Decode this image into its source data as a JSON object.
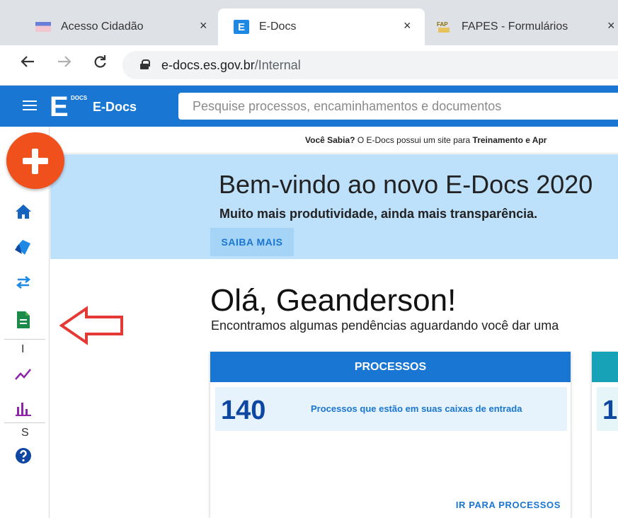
{
  "browser": {
    "tabs": [
      {
        "label": "Acesso Cidadão",
        "active": false
      },
      {
        "label": "E-Docs",
        "active": true
      },
      {
        "label": "FAPES - Formulários",
        "active": false
      }
    ],
    "close_glyph": "×",
    "url_host": "e-docs.es.gov.br",
    "url_path": "/Internal"
  },
  "header": {
    "logo_letter": "E",
    "logo_small": "DOCS",
    "brand": "E-Docs",
    "search_placeholder": "Pesquise processos, encaminhamentos e documentos"
  },
  "sidebar": {
    "section_letters": [
      "I",
      "S"
    ],
    "icons": [
      "home-icon",
      "tags-icon",
      "exchange-icon",
      "document-icon",
      "trend-chart-icon",
      "bar-chart-icon",
      "help-icon"
    ]
  },
  "tip": {
    "lead": "Você Sabia?",
    "text": " O E-Docs possui um site para ",
    "strong": "Treinamento e Apr"
  },
  "banner": {
    "title": "Bem-vindo ao novo E-Docs 2020",
    "subtitle": "Muito mais produtividade, ainda mais transparência.",
    "button": "SAIBA MAIS"
  },
  "greeting": {
    "title": "Olá, Geanderson!",
    "subtitle": "Encontramos algumas pendências aguardando você dar uma"
  },
  "cards": [
    {
      "header": "PROCESSOS",
      "count": "140",
      "description": "Processos que estão em suas caixas de entrada",
      "link": "IR PARA PROCESSOS"
    },
    {
      "count": "1"
    }
  ],
  "colors": {
    "primary": "#1976d2",
    "fab": "#f0501c",
    "banner": "#bde0fb",
    "annotation_arrow": "#e53935"
  }
}
